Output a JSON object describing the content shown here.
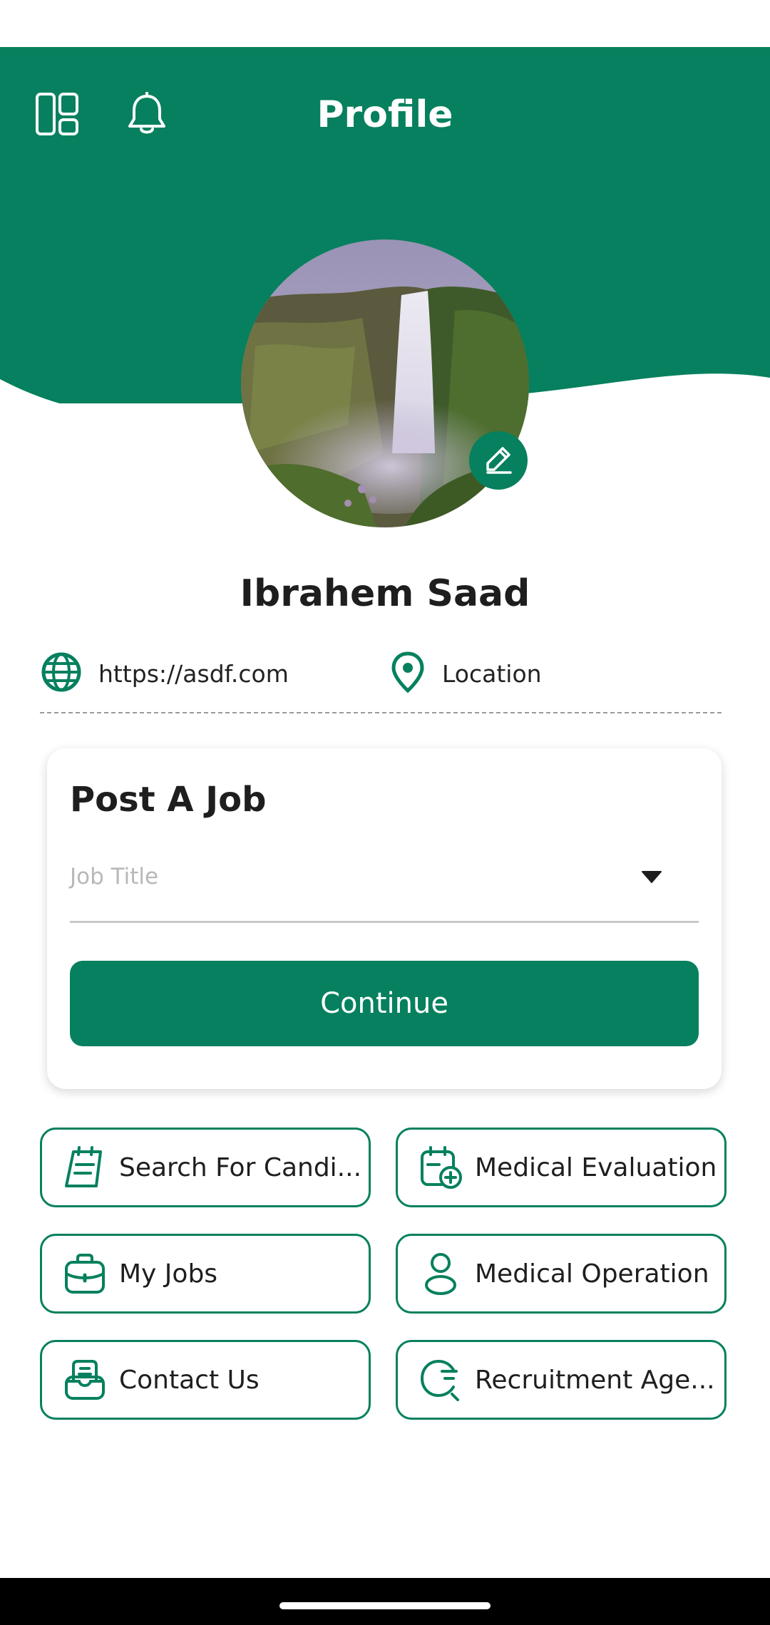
{
  "header": {
    "title": "Profile",
    "menu_icon": "dashboard-icon",
    "notification_icon": "bell-icon"
  },
  "profile": {
    "name": "Ibrahem Saad",
    "avatar": "waterfall-landscape-photo",
    "edit_icon": "pencil-icon",
    "website": "https://asdf.com",
    "location": "Location"
  },
  "post_job": {
    "title": "Post A Job",
    "job_title_placeholder": "Job Title",
    "continue_label": "Continue"
  },
  "actions": [
    {
      "label": "Search For Candi...",
      "icon": "calendar-note-icon"
    },
    {
      "label": "Medical Evaluation",
      "icon": "calendar-medical-icon"
    },
    {
      "label": "My Jobs",
      "icon": "briefcase-icon"
    },
    {
      "label": "Medical Operation",
      "icon": "person-icon"
    },
    {
      "label": "Contact Us",
      "icon": "inbox-icon"
    },
    {
      "label": "Recruitment Age...",
      "icon": "search-list-icon"
    }
  ],
  "colors": {
    "primary": "#06805e",
    "background": "#ffffff",
    "text": "#1e1e1e"
  }
}
